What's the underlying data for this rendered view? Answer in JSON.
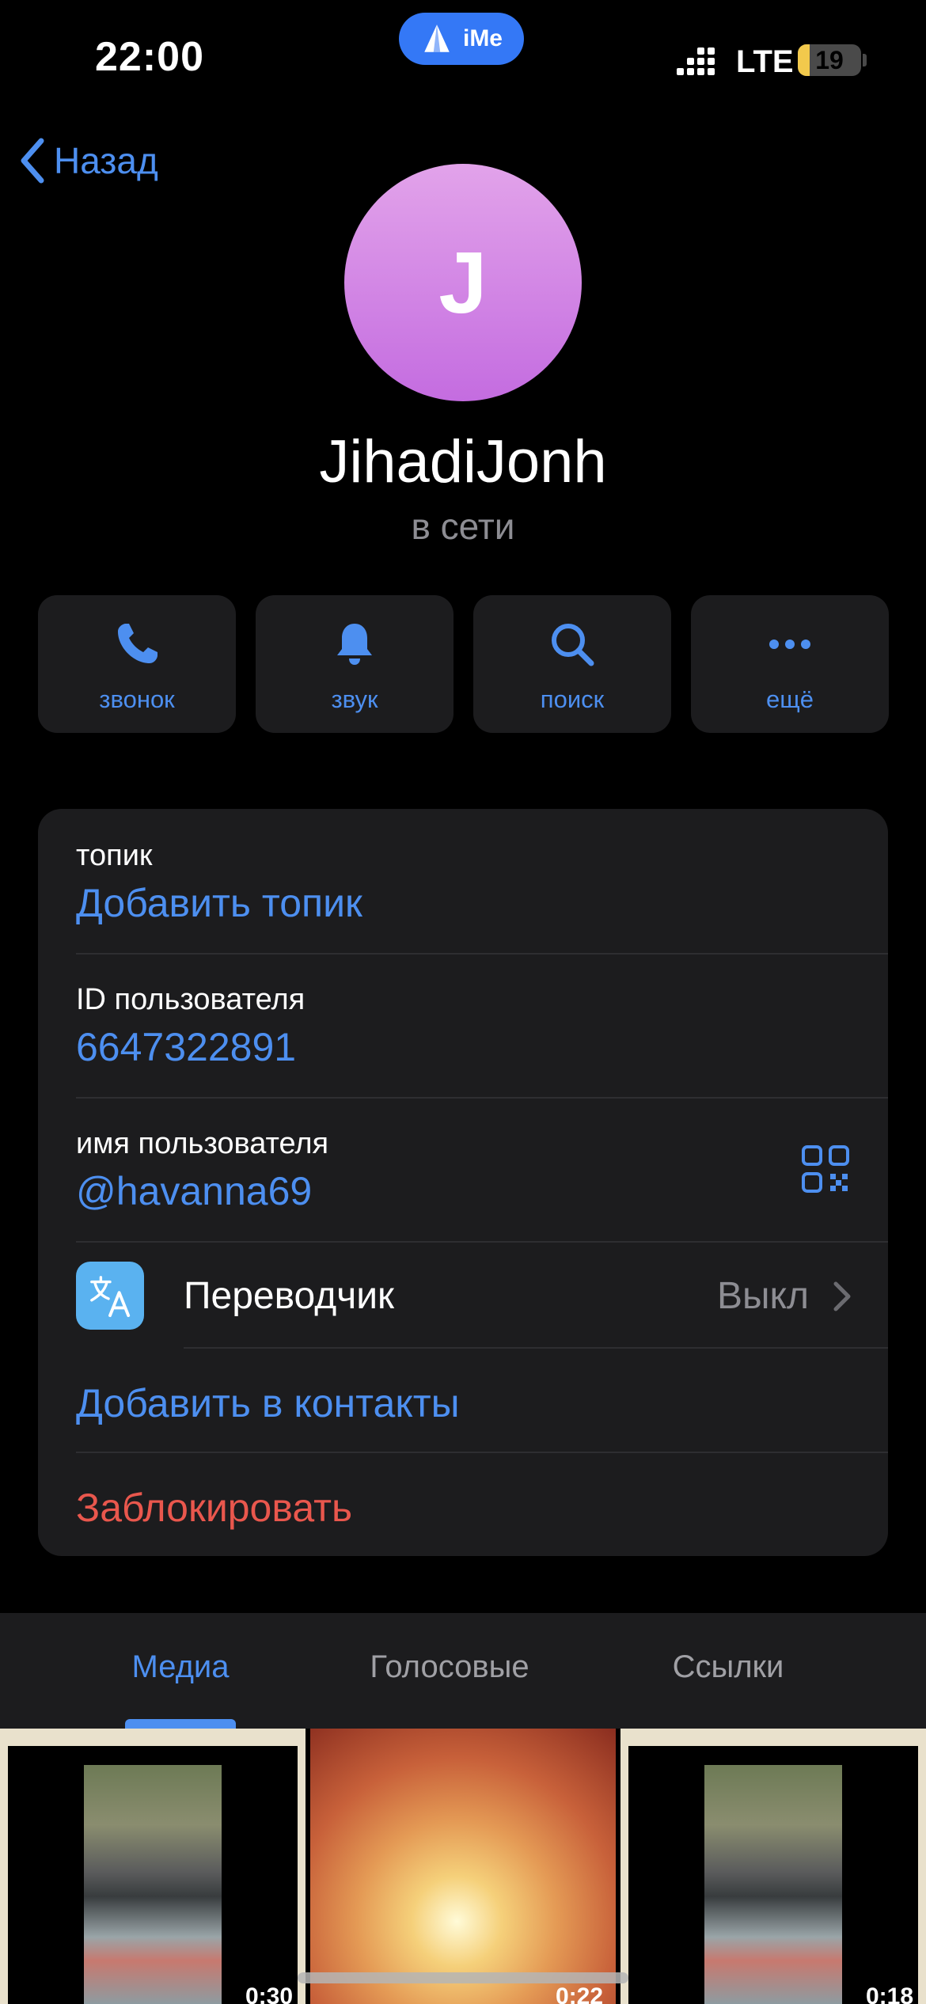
{
  "status_bar": {
    "time": "22:00",
    "ime_badge": "iMe",
    "network": "LTE",
    "battery": "19",
    "battery_level": 0.19
  },
  "nav": {
    "back_label": "Назад"
  },
  "profile": {
    "avatar_initial": "J",
    "avatar_gradient": [
      "#e2a3ea",
      "#c46ce0"
    ],
    "name": "JihadiJonh",
    "status": "в сети"
  },
  "actions": [
    {
      "label": "звонок",
      "icon": "phone-icon"
    },
    {
      "label": "звук",
      "icon": "bell-icon"
    },
    {
      "label": "поиск",
      "icon": "search-icon"
    },
    {
      "label": "ещё",
      "icon": "more-icon"
    }
  ],
  "info": {
    "topic_label": "топик",
    "topic_action": "Добавить топик",
    "user_id_label": "ID пользователя",
    "user_id": "6647322891",
    "username_label": "имя пользователя",
    "username": "@havanna69",
    "translator_label": "Переводчик",
    "translator_value": "Выкл",
    "add_contact": "Добавить в контакты",
    "block": "Заблокировать"
  },
  "tabs": [
    {
      "label": "Медиа",
      "active": true
    },
    {
      "label": "Голосовые",
      "active": false
    },
    {
      "label": "Ссылки",
      "active": false
    }
  ],
  "media": [
    {
      "duration": "0:30"
    },
    {
      "duration": "0:22"
    },
    {
      "duration": "0:18"
    }
  ],
  "colors": {
    "accent": "#4d8ff0",
    "destructive": "#e9574d",
    "card": "#1c1c1e",
    "secondary_text": "#8d8d93"
  }
}
